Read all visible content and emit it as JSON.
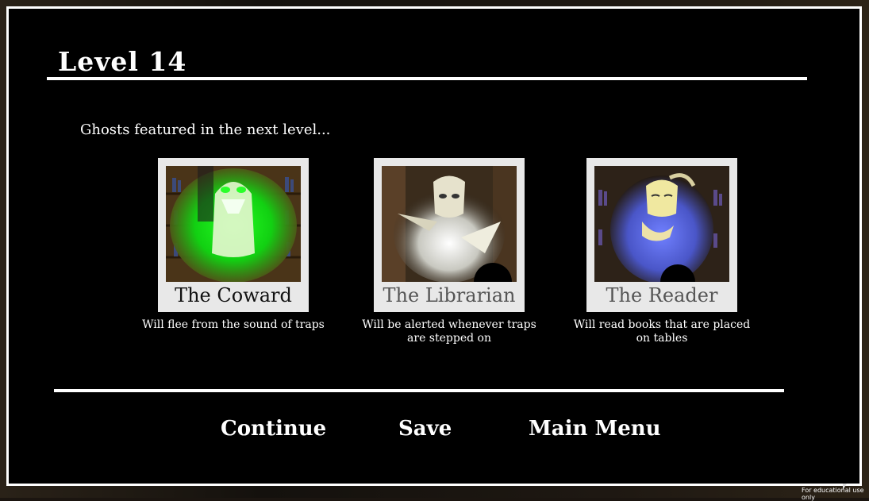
{
  "header": {
    "title": "Level 14"
  },
  "intro": {
    "text": "Ghosts featured in the next level..."
  },
  "ghosts": [
    {
      "name": "The Coward",
      "description": "Will flee from the sound of traps",
      "glow": "#19e619"
    },
    {
      "name": "The Librarian",
      "description": "Will be alerted whenever traps are stepped on",
      "glow": "#ffffff"
    },
    {
      "name": "The Reader",
      "description": "Will read books that are placed on tables",
      "glow": "#5b6ee6"
    }
  ],
  "menu": {
    "continue": "Continue",
    "save": "Save",
    "main_menu": "Main Menu"
  },
  "footer": {
    "watermark": "For educational use only"
  },
  "colors": {
    "panel": "#000000",
    "border": "#ffffff",
    "card": "#e8e8e8"
  }
}
